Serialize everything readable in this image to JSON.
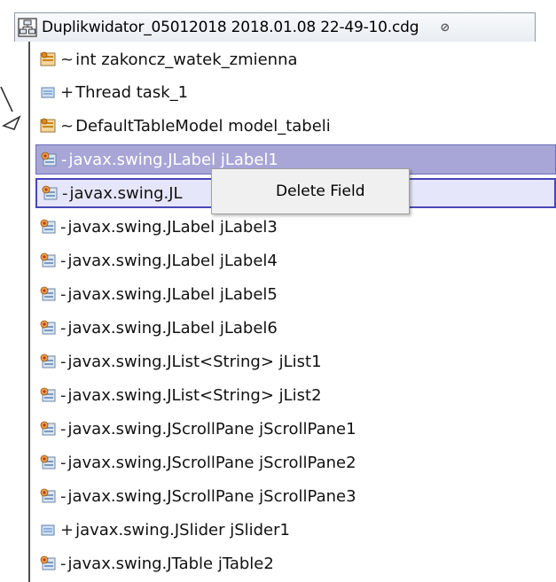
{
  "tab": {
    "title": "Duplikwidator_05012018 2018.01.08 22-49-10.cdg",
    "close_symbol": "⊘",
    "icon": "class-diagram-icon"
  },
  "fields": [
    {
      "modifier": "~",
      "text": "int zakoncz_watek_zmienna",
      "icon": "field-package-icon",
      "state": "normal"
    },
    {
      "modifier": "+",
      "text": "Thread task_1",
      "icon": "field-public-icon",
      "state": "normal"
    },
    {
      "modifier": "~",
      "text": "DefaultTableModel model_tabeli",
      "icon": "field-package-icon",
      "state": "normal"
    },
    {
      "modifier": "-",
      "text": "javax.swing.JLabel jLabel1",
      "icon": "field-private-icon",
      "state": "selected"
    },
    {
      "modifier": "-",
      "text": "javax.swing.JL",
      "icon": "field-private-icon",
      "state": "focused"
    },
    {
      "modifier": "-",
      "text": "javax.swing.JLabel jLabel3",
      "icon": "field-private-icon",
      "state": "normal"
    },
    {
      "modifier": "-",
      "text": "javax.swing.JLabel jLabel4",
      "icon": "field-private-icon",
      "state": "normal"
    },
    {
      "modifier": "-",
      "text": "javax.swing.JLabel jLabel5",
      "icon": "field-private-icon",
      "state": "normal"
    },
    {
      "modifier": "-",
      "text": "javax.swing.JLabel jLabel6",
      "icon": "field-private-icon",
      "state": "normal"
    },
    {
      "modifier": "-",
      "text": "javax.swing.JList<String> jList1",
      "icon": "field-private-icon",
      "state": "normal"
    },
    {
      "modifier": "-",
      "text": "javax.swing.JList<String> jList2",
      "icon": "field-private-icon",
      "state": "normal"
    },
    {
      "modifier": "-",
      "text": "javax.swing.JScrollPane jScrollPane1",
      "icon": "field-private-icon",
      "state": "normal"
    },
    {
      "modifier": "-",
      "text": "javax.swing.JScrollPane jScrollPane2",
      "icon": "field-private-icon",
      "state": "normal"
    },
    {
      "modifier": "-",
      "text": "javax.swing.JScrollPane jScrollPane3",
      "icon": "field-private-icon",
      "state": "normal"
    },
    {
      "modifier": "+",
      "text": "javax.swing.JSlider jSlider1",
      "icon": "field-public-icon",
      "state": "normal"
    },
    {
      "modifier": "-",
      "text": "javax.swing.JTable jTable2",
      "icon": "field-private-icon",
      "state": "normal"
    }
  ],
  "context_menu": {
    "items": [
      {
        "label": "Delete Field"
      }
    ]
  },
  "colors": {
    "selected_bg": "#a7a6d6",
    "focused_bg": "#e6e6fa",
    "focused_border": "#4747b8",
    "menu_bg": "#f0f0f0"
  }
}
